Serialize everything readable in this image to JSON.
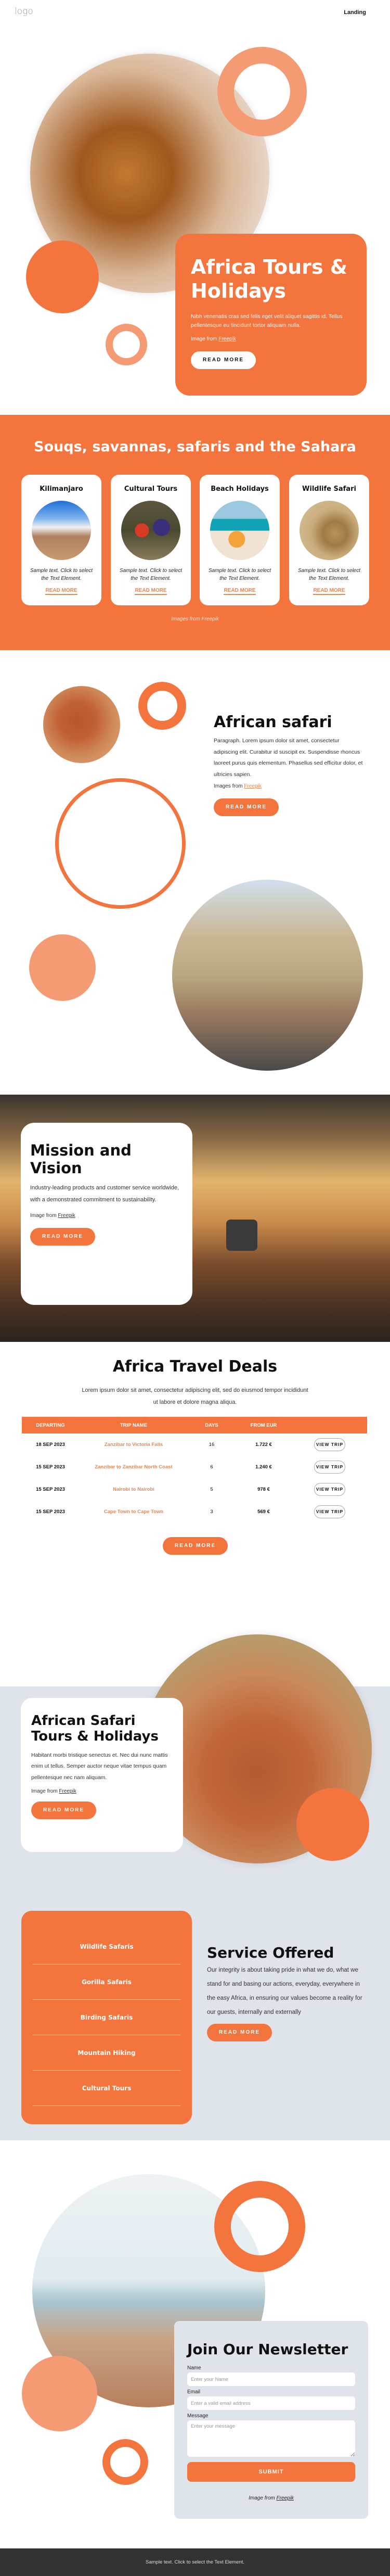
{
  "header": {
    "logo": "logo",
    "nav": [
      {
        "label": "Landing"
      }
    ]
  },
  "colors": {
    "accent": "#f4743d",
    "accent_light": "#f59b74",
    "panel_gray": "#dfe3ea",
    "footer": "#333333"
  },
  "hero": {
    "title": "Africa Tours & Holidays",
    "text": "Nibh venenatis cras sed felis eget velit aliquet sagittis id. Tellus pellentesque eu tincidunt tortor aliquam nulla.",
    "credit_prefix": "Image from",
    "credit_link": "Freepik",
    "button": "READ MORE",
    "image": "tiger-photo"
  },
  "souqs": {
    "title": "Souqs, savannas, safaris and the Sahara",
    "cards": [
      {
        "title": "Kilimanjaro",
        "image": "mountain-photo",
        "text": "Sample text. Click to select the Text Element.",
        "link": "READ MORE"
      },
      {
        "title": "Cultural Tours",
        "image": "maasai-photo",
        "text": "Sample text. Click to select the Text Element.",
        "link": "READ MORE"
      },
      {
        "title": "Beach Holidays",
        "image": "beach-photo",
        "text": "Sample text. Click to select the Text Element.",
        "link": "READ MORE"
      },
      {
        "title": "Wildlife Safari",
        "image": "cheetah-photo",
        "text": "Sample text. Click to select the Text Element.",
        "link": "READ MORE"
      }
    ],
    "credit_prefix": "Images from",
    "credit_link": "Freepik"
  },
  "safari": {
    "title": "African safari",
    "text": "Paragraph. Lorem ipsum dolor sit amet, consectetur adipiscing elit. Curabitur id suscipit ex. Suspendisse rhoncus laoreet purus quis elementum. Phasellus sed efficitur dolor, et ultricies sapien.",
    "credit_prefix": "Images from",
    "credit_link": "Freepik",
    "button": "READ MORE"
  },
  "mission": {
    "title": "Mission and Vision",
    "text": "Industry-leading products and customer service worldwide, with a demonstrated commitment to sustainability.",
    "credit_prefix": "Image from",
    "credit_link": "Freepik",
    "button": "READ MORE"
  },
  "deals": {
    "title": "Africa Travel Deals",
    "subtitle": "Lorem ipsum dolor sit amet, consectetur adipiscing elit, sed do eiusmod tempor incididunt ut labore et dolore magna aliqua.",
    "columns": [
      "DEPARTING",
      "TRIP NAME",
      "DAYS",
      "FROM EUR",
      ""
    ],
    "rows": [
      {
        "departing": "18 SEP 2023",
        "trip": "Zanzibar to Victoria Falls",
        "days": "16",
        "price": "1.722 €",
        "action": "VIEW TRIP"
      },
      {
        "departing": "15 SEP 2023",
        "trip": "Zanzibar to Zanzibar North Coast",
        "days": "6",
        "price": "1.240 €",
        "action": "VIEW TRIP"
      },
      {
        "departing": "15 SEP 2023",
        "trip": "Nairobi to Nairobi",
        "days": "5",
        "price": "978 €",
        "action": "VIEW TRIP"
      },
      {
        "departing": "15 SEP 2023",
        "trip": "Cape Town to Cape Town",
        "days": "3",
        "price": "569 €",
        "action": "VIEW TRIP"
      }
    ],
    "button": "READ MORE"
  },
  "tours": {
    "title": "African Safari Tours & Holidays",
    "text": "Habitant morbi tristique senectus et. Nec dui nunc mattis enim ut tellus. Semper auctor neque vitae tempus quam pellentesque nec nam aliquam.",
    "credit_prefix": "Image from",
    "credit_link": "Freepik",
    "button": "READ MORE"
  },
  "services": {
    "items": [
      "Wildlife Safaris",
      "Gorilla Safaris",
      "Birding Safaris",
      "Mountain Hiking",
      "Cultural Tours"
    ],
    "title": "Service Offered",
    "text": "Our integrity is about taking pride in what we do, what we stand for and basing our actions, everyday, everywhere in the easy Africa, in ensuring our values become a reality for our guests, internally and externally",
    "button": "READ MORE"
  },
  "newsletter": {
    "title": "Join Our Newsletter",
    "name_label": "Name",
    "name_placeholder": "Enter your Name",
    "email_label": "Email",
    "email_placeholder": "Enter a valid email address",
    "message_label": "Message",
    "message_placeholder": "Enter your message",
    "submit": "SUBMIT",
    "credit_prefix": "Image from",
    "credit_link": "Freepik"
  },
  "footer": {
    "text": "Sample text. Click to select the Text Element."
  }
}
